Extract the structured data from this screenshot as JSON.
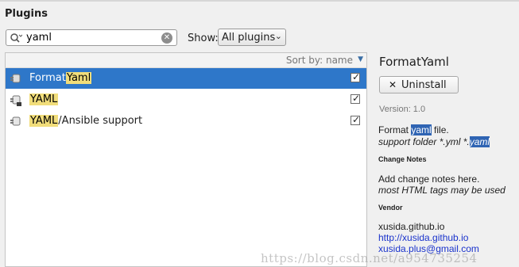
{
  "dialog": {
    "title": "Plugins"
  },
  "search": {
    "value": "yaml",
    "placeholder": ""
  },
  "filter": {
    "label": "Show:",
    "selected": "All plugins"
  },
  "sort": {
    "label": "Sort by: name"
  },
  "plugins": [
    {
      "prefix": "Format",
      "highlight": "Yaml",
      "suffix": "",
      "enabled": true,
      "selected": true
    },
    {
      "prefix": "",
      "highlight": "YAML",
      "suffix": "",
      "enabled": true,
      "selected": false
    },
    {
      "prefix": "",
      "highlight": "YAML",
      "suffix": "/Ansible support",
      "enabled": true,
      "selected": false
    }
  ],
  "details": {
    "name": "FormatYaml",
    "uninstall_label": "Uninstall",
    "version": "Version: 1.0",
    "description": {
      "line1_pre": "Format ",
      "line1_sel": "yaml",
      "line1_post": " file.",
      "line2_pre": "support folder *.yml *.",
      "line2_sel": "yaml"
    },
    "change_notes_heading": "Change Notes",
    "change_notes_line1": "Add change notes here.",
    "change_notes_line2": "most HTML tags may be used",
    "vendor_heading": "Vendor",
    "vendor_name": "xusida.github.io",
    "vendor_url": "http://xusida.github.io",
    "vendor_email": "xusida.plus@gmail.com"
  },
  "watermark": "https://blog.csdn.net/a954735254",
  "colors": {
    "selection": "#2e77c9",
    "match_highlight": "#f1dd7a",
    "link": "#1a33cc"
  },
  "icons": [
    "search-icon",
    "clear-icon",
    "chevron-down-icon",
    "plugin-icon",
    "checkbox-checked-icon",
    "close-icon"
  ]
}
